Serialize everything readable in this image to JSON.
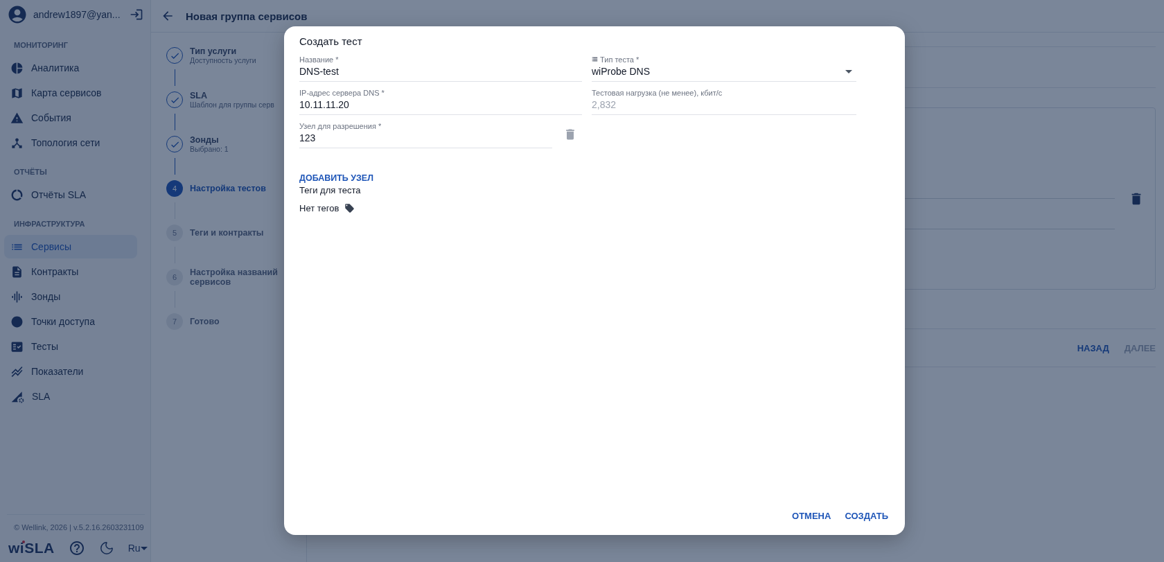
{
  "user": {
    "email": "andrew1897@yan..."
  },
  "sidebar": {
    "sections": [
      {
        "title": "МОНИТОРИНГ",
        "items": [
          {
            "label": "Аналитика",
            "selected": false
          },
          {
            "label": "Карта сервисов",
            "selected": false
          },
          {
            "label": "События",
            "selected": false
          },
          {
            "label": "Топология сети",
            "selected": false
          }
        ]
      },
      {
        "title": "ОТЧЁТЫ",
        "items": [
          {
            "label": "Отчёты SLA",
            "selected": false
          }
        ]
      },
      {
        "title": "ИНФРАСТРУКТУРА",
        "items": [
          {
            "label": "Сервисы",
            "selected": true
          },
          {
            "label": "Контракты",
            "selected": false
          },
          {
            "label": "Зонды",
            "selected": false
          },
          {
            "label": "Точки доступа",
            "selected": false
          },
          {
            "label": "Тесты",
            "selected": false
          },
          {
            "label": "Показатели",
            "selected": false
          },
          {
            "label": "SLA",
            "selected": false
          }
        ]
      }
    ],
    "copyright": "© Wellink, 2026 | v.5.2.16.2603231109",
    "logo": "wiSLA",
    "language": "Ru"
  },
  "page": {
    "title": "Новая группа сервисов",
    "steps": [
      {
        "title": "Тип услуги",
        "subtitle": "Доступность услуги",
        "done": true,
        "selected": false
      },
      {
        "title": "SLA",
        "subtitle": "Шаблон для группы серв",
        "done": true,
        "selected": false
      },
      {
        "title": "Зонды",
        "subtitle": "Выбрано: 1",
        "done": true,
        "selected": false
      },
      {
        "number": "4",
        "title": "Настройка тестов",
        "done": false,
        "selected": true
      },
      {
        "number": "5",
        "title": "Теги и контракты",
        "done": false,
        "selected": false
      },
      {
        "number": "6",
        "title": "Настройка названий сервисов",
        "done": false,
        "selected": false
      },
      {
        "number": "7",
        "title": "Готово",
        "done": false,
        "selected": false
      }
    ],
    "actions": [
      {
        "label": "НАЗАД",
        "disabled": false
      },
      {
        "label": "ДАЛЕЕ",
        "disabled": true
      }
    ]
  },
  "dialog": {
    "title": "Создать тест",
    "fields": [
      {
        "label": "Название *",
        "value": "DNS-test",
        "kind": "text",
        "disabled": false
      },
      {
        "label": "Тип теста *",
        "value": "wiProbe DNS",
        "kind": "select",
        "disabled": false
      },
      {
        "label": "IP-адрес сервера DNS *",
        "value": "10.11.11.20",
        "kind": "text",
        "disabled": false
      },
      {
        "label": "Тестовая нагрузка (не менее), кбит/с",
        "value": "2,832",
        "kind": "text",
        "disabled": true
      }
    ],
    "nodes": [
      {
        "label": "Узел для разрешения *",
        "value": "123"
      }
    ],
    "add_node": "ДОБАВИТЬ УЗЕЛ",
    "tags_title": "Теги для теста",
    "tags_empty": "Нет тегов",
    "buttons": [
      "ОТМЕНА",
      "СОЗДАТЬ"
    ]
  }
}
